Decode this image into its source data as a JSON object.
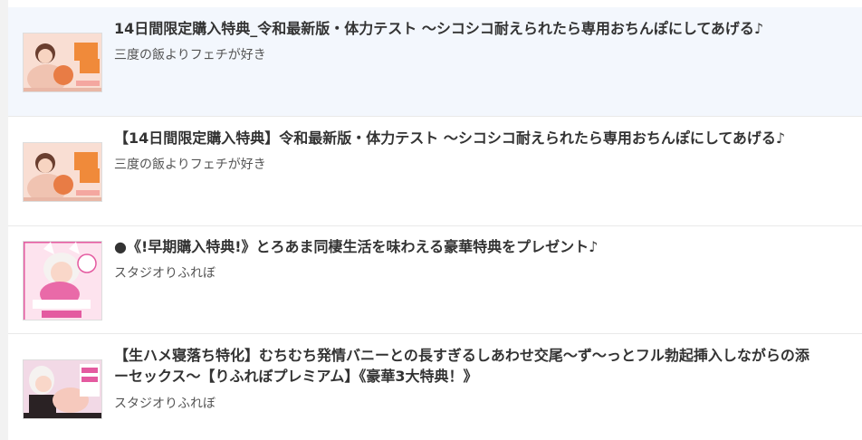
{
  "items": [
    {
      "title": "14日間限定購入特典_令和最新版・体力テスト ～シコシコ耐えられたら専用おちんぽにしてあげる♪",
      "circle": "三度の飯よりフェチが好き",
      "thumbnail_icon": "product-cover-image"
    },
    {
      "title": "【14日間限定購入特典】令和最新版・体力テスト ～シコシコ耐えられたら専用おちんぽにしてあげる♪",
      "circle": "三度の飯よりフェチが好き",
      "thumbnail_icon": "product-cover-image"
    },
    {
      "title": "●《!早期購入特典!》とろあま同棲生活を味わえる豪華特典をプレゼント♪",
      "circle": "スタジオりふれぼ",
      "thumbnail_icon": "product-cover-image"
    },
    {
      "title_line1": "【生ハメ寝落ち特化】むちむち発情バニーとの長すぎるしあわせ交尾～ず～っとフル勃起挿入しながらの添",
      "title_line2": "ーセックス～【りふれぼプレミアム】《豪華3大特典！》",
      "circle": "スタジオりふれぼ",
      "thumbnail_icon": "product-cover-image"
    }
  ]
}
